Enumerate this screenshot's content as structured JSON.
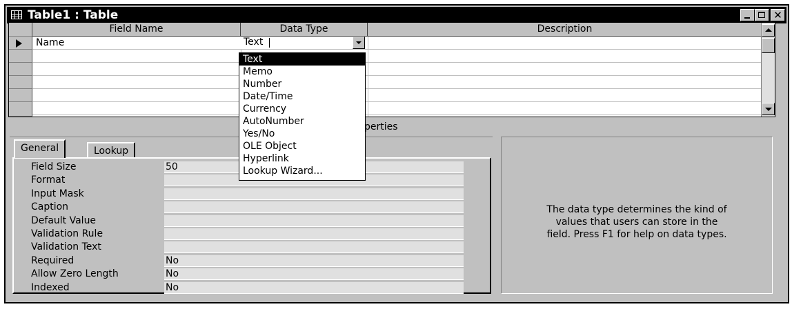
{
  "window": {
    "title": "Table1 : Table"
  },
  "grid": {
    "headers": {
      "field_name": "Field Name",
      "data_type": "Data Type",
      "description": "Description"
    },
    "current_row": {
      "field_name": "Name",
      "data_type": "Text"
    }
  },
  "dropdown": {
    "items": [
      "Text",
      "Memo",
      "Number",
      "Date/Time",
      "Currency",
      "AutoNumber",
      "Yes/No",
      "OLE Object",
      "Hyperlink",
      "Lookup Wizard..."
    ],
    "selected": "Text"
  },
  "field_properties": {
    "label": "eld Properties",
    "tabs": {
      "general": "General",
      "lookup": "Lookup"
    },
    "rows": [
      {
        "label": "Field Size",
        "value": "50"
      },
      {
        "label": "Format",
        "value": ""
      },
      {
        "label": "Input Mask",
        "value": ""
      },
      {
        "label": "Caption",
        "value": ""
      },
      {
        "label": "Default Value",
        "value": ""
      },
      {
        "label": "Validation Rule",
        "value": ""
      },
      {
        "label": "Validation Text",
        "value": ""
      },
      {
        "label": "Required",
        "value": "No"
      },
      {
        "label": "Allow Zero Length",
        "value": "No"
      },
      {
        "label": "Indexed",
        "value": "No"
      }
    ]
  },
  "help": {
    "line1": "The data type determines the kind of",
    "line2": "values that users can store in the",
    "line3": "field.  Press F1 for help on data types."
  }
}
